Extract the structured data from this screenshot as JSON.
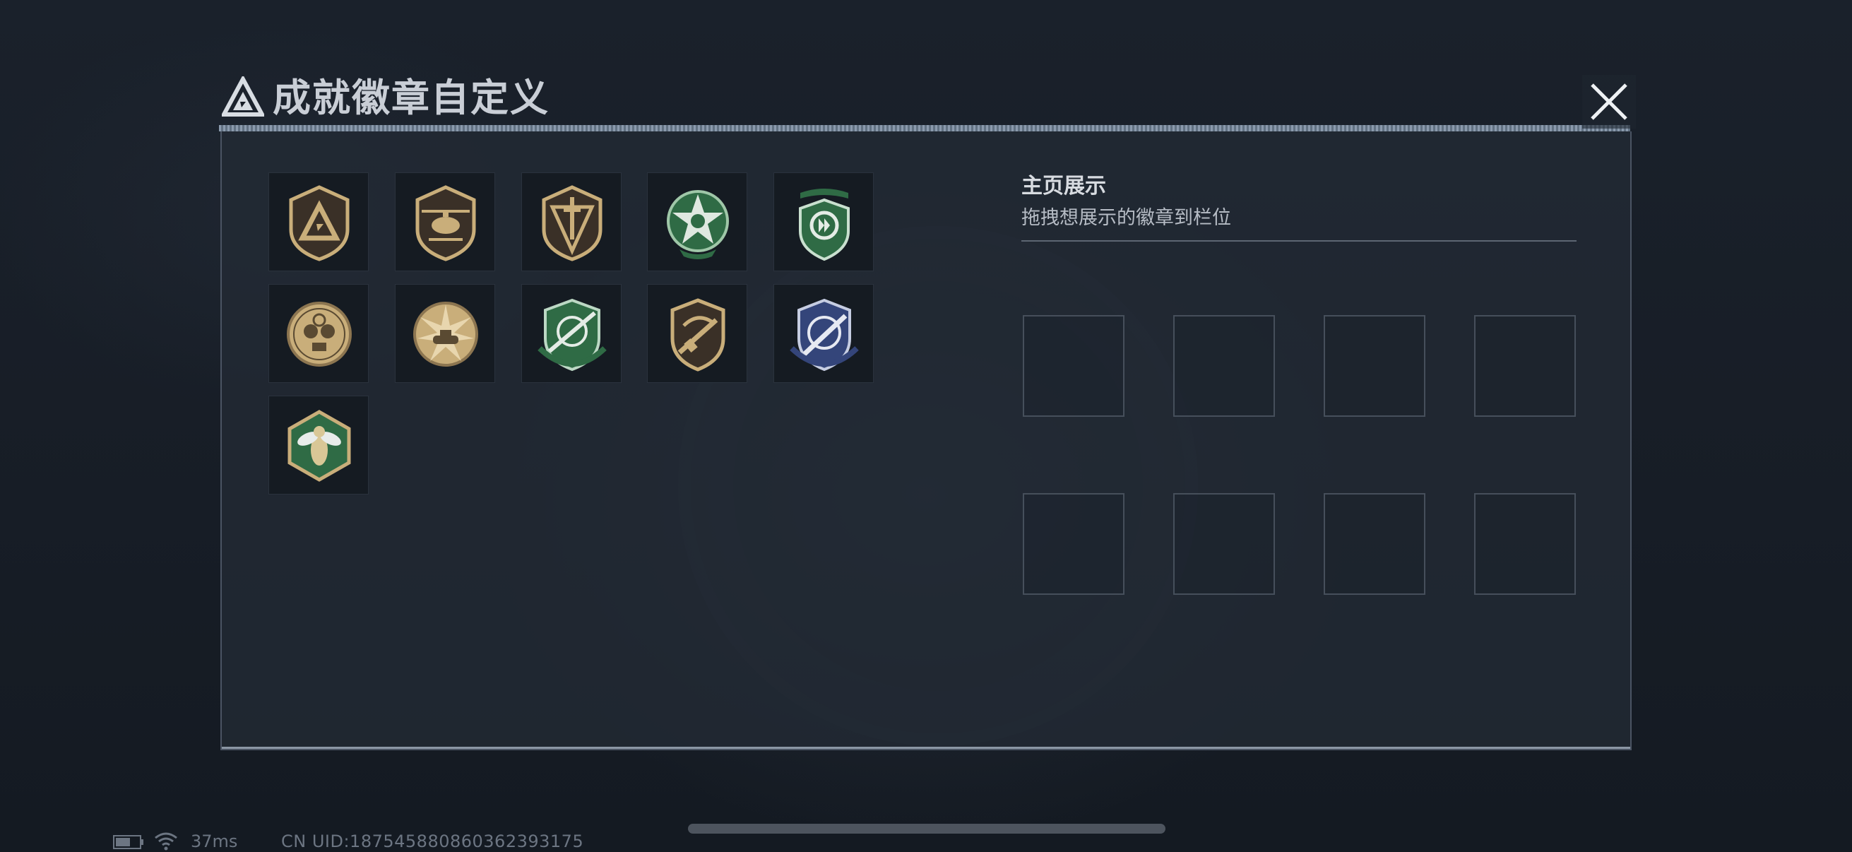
{
  "dialog": {
    "title": "成就徽章自定义",
    "title_icon": "triangle-logo-icon",
    "close_icon": "close-icon"
  },
  "badges": [
    {
      "icon": "gold-triangle-shield-badge-icon",
      "color": "#b8a070"
    },
    {
      "icon": "helicopter-shield-badge-icon",
      "color": "#b8a070"
    },
    {
      "icon": "dagger-shield-badge-icon",
      "color": "#b8a070"
    },
    {
      "icon": "green-star-skull-badge-icon",
      "color": "#2f6b45"
    },
    {
      "icon": "green-crest-badge-icon",
      "color": "#2f6b45"
    },
    {
      "icon": "crosshair-skull-medal-icon",
      "color": "#b8a070"
    },
    {
      "icon": "sunburst-tank-medal-icon",
      "color": "#b8a070"
    },
    {
      "icon": "green-sniper-shield-badge-icon",
      "color": "#2f6b45"
    },
    {
      "icon": "gold-rifle-shield-badge-icon",
      "color": "#b8a070"
    },
    {
      "icon": "blue-rifle-shield-badge-icon",
      "color": "#34457a"
    },
    {
      "icon": "hornet-hexagon-badge-icon",
      "color": "#2f6b45"
    }
  ],
  "showcase": {
    "title": "主页展示",
    "subtitle": "拖拽想展示的徽章到栏位",
    "slot_count": 8
  },
  "status": {
    "ping": "37ms",
    "uid": "CN UID:18754588086036239​3175",
    "battery_icon": "battery-icon",
    "wifi_icon": "wifi-icon"
  }
}
